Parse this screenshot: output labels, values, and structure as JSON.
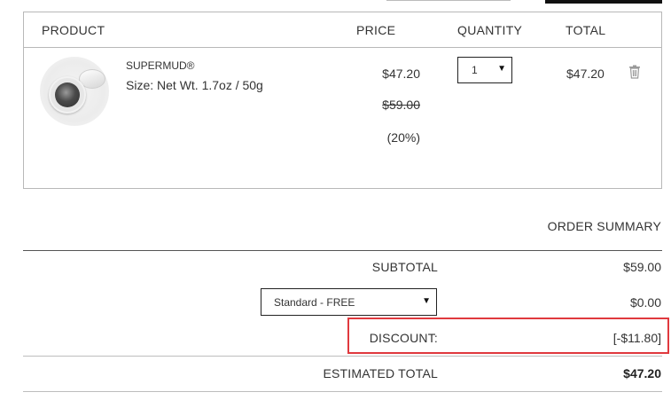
{
  "cart": {
    "headers": {
      "product": "PRODUCT",
      "price": "PRICE",
      "quantity": "QUANTITY",
      "total": "TOTAL"
    },
    "item": {
      "name": "SUPERMUD®",
      "size": "Size: Net Wt. 1.7oz / 50g",
      "price_now": "$47.20",
      "price_was": "$59.00",
      "discount_pct": "(20%)",
      "quantity": "1",
      "line_total": "$47.20",
      "image_icon": "product-jar-icon",
      "delete_icon": "trash-icon"
    }
  },
  "summary": {
    "title": "ORDER SUMMARY",
    "subtotal_label": "SUBTOTAL",
    "subtotal_value": "$59.00",
    "shipping_option": "Standard - FREE",
    "shipping_value": "$0.00",
    "discount_label": "DISCOUNT:",
    "discount_value": "[-$11.80]",
    "estimated_total_label": "ESTIMATED TOTAL",
    "estimated_total_value": "$47.20"
  },
  "colors": {
    "highlight_border": "#e0393e",
    "text": "#333333",
    "border": "#b8b8b8"
  }
}
